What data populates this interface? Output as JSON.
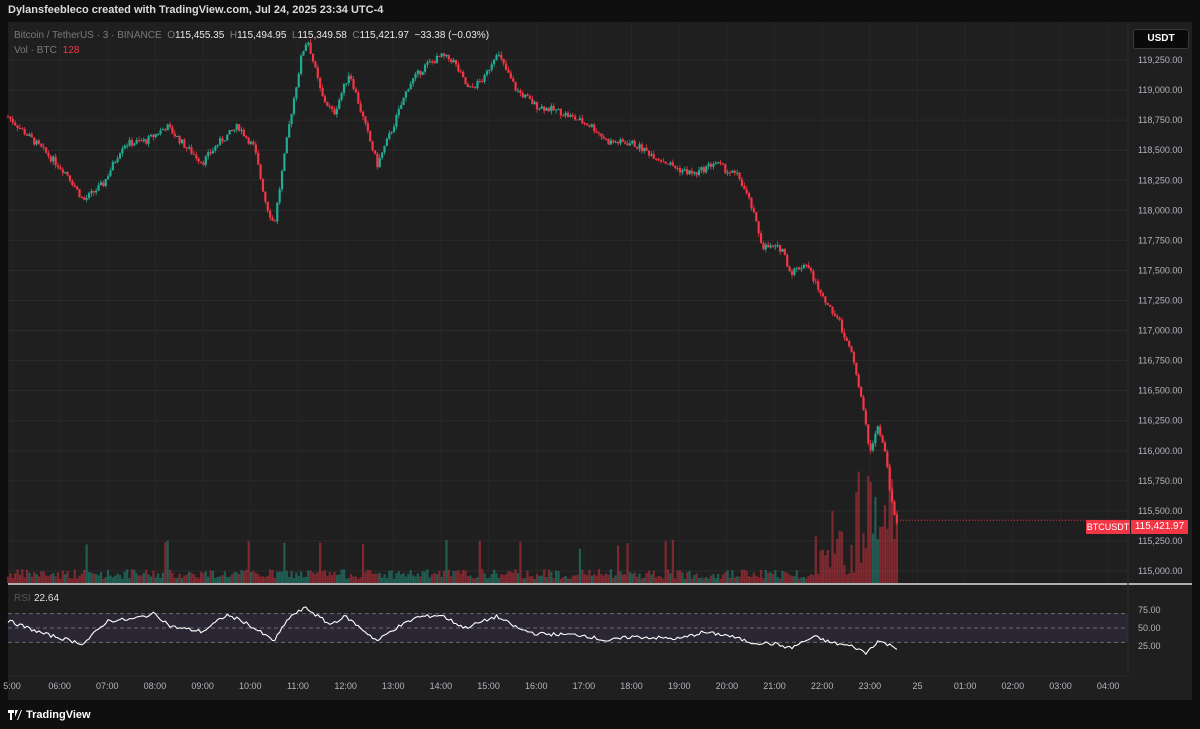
{
  "header": {
    "credit": "Dylansfeebleco created with TradingView.com, Jul 24, 2025 23:34 UTC-4"
  },
  "legend": {
    "symbol": "Bitcoin / TetherUS · 3 · BINANCE",
    "o_label": "O",
    "o": "115,455.35",
    "h_label": "H",
    "h": "115,494.95",
    "l_label": "L",
    "l": "115,349.58",
    "c_label": "C",
    "c": "115,421.97",
    "change": "−33.38 (−0.03%)",
    "vol_label": "Vol · BTC",
    "vol_value": "128",
    "rsi_label": "RSI",
    "rsi_value": "22.64"
  },
  "currency_button": "USDT",
  "price_tag": {
    "symbol": "BTCUSDT",
    "value": "115,421.97"
  },
  "footer": {
    "brand": "TradingView"
  },
  "colors": {
    "up": "#22ab94",
    "down": "#f23645",
    "rsi": "#ffffff",
    "rsi_band": "#7e57c2"
  },
  "chart_data": [
    {
      "type": "candlestick",
      "title": "Bitcoin / TetherUS · 3 · BINANCE",
      "x_labels": [
        "5:00",
        "06:00",
        "07:00",
        "08:00",
        "09:00",
        "10:00",
        "11:00",
        "12:00",
        "13:00",
        "14:00",
        "15:00",
        "16:00",
        "17:00",
        "18:00",
        "19:00",
        "20:00",
        "21:00",
        "22:00",
        "23:00",
        "25",
        "01:00",
        "02:00",
        "03:00",
        "04:00"
      ],
      "y_ticks": [
        "119,250.00",
        "119,000.00",
        "118,750.00",
        "118,500.00",
        "118,250.00",
        "118,000.00",
        "117,750.00",
        "117,500.00",
        "117,250.00",
        "117,000.00",
        "116,750.00",
        "116,500.00",
        "116,250.00",
        "116,000.00",
        "115,750.00",
        "115,500.00",
        "115,250.00",
        "115,000.00"
      ],
      "ylim": [
        114950,
        119500
      ],
      "bar_minutes": 3,
      "close_path_anchors": [
        {
          "t": "04:55",
          "p": 118780
        },
        {
          "t": "05:30",
          "p": 118560
        },
        {
          "t": "06:10",
          "p": 118300
        },
        {
          "t": "06:30",
          "p": 118080
        },
        {
          "t": "06:55",
          "p": 118220
        },
        {
          "t": "07:20",
          "p": 118550
        },
        {
          "t": "07:50",
          "p": 118580
        },
        {
          "t": "08:15",
          "p": 118700
        },
        {
          "t": "08:40",
          "p": 118520
        },
        {
          "t": "09:00",
          "p": 118400
        },
        {
          "t": "09:20",
          "p": 118560
        },
        {
          "t": "09:45",
          "p": 118700
        },
        {
          "t": "10:05",
          "p": 118520
        },
        {
          "t": "10:20",
          "p": 118050
        },
        {
          "t": "10:30",
          "p": 117880
        },
        {
          "t": "10:50",
          "p": 118750
        },
        {
          "t": "11:05",
          "p": 119300
        },
        {
          "t": "11:12",
          "p": 119430
        },
        {
          "t": "11:30",
          "p": 118950
        },
        {
          "t": "11:45",
          "p": 118800
        },
        {
          "t": "12:05",
          "p": 119150
        },
        {
          "t": "12:25",
          "p": 118700
        },
        {
          "t": "12:40",
          "p": 118380
        },
        {
          "t": "13:00",
          "p": 118700
        },
        {
          "t": "13:20",
          "p": 119050
        },
        {
          "t": "13:40",
          "p": 119200
        },
        {
          "t": "14:00",
          "p": 119280
        },
        {
          "t": "14:15",
          "p": 119250
        },
        {
          "t": "14:35",
          "p": 119000
        },
        {
          "t": "14:55",
          "p": 119100
        },
        {
          "t": "15:10",
          "p": 119320
        },
        {
          "t": "15:35",
          "p": 119000
        },
        {
          "t": "16:00",
          "p": 118870
        },
        {
          "t": "16:30",
          "p": 118820
        },
        {
          "t": "17:10",
          "p": 118700
        },
        {
          "t": "17:30",
          "p": 118570
        },
        {
          "t": "18:00",
          "p": 118560
        },
        {
          "t": "18:30",
          "p": 118450
        },
        {
          "t": "19:00",
          "p": 118340
        },
        {
          "t": "19:20",
          "p": 118300
        },
        {
          "t": "19:45",
          "p": 118400
        },
        {
          "t": "20:00",
          "p": 118330
        },
        {
          "t": "20:15",
          "p": 118280
        },
        {
          "t": "20:30",
          "p": 118050
        },
        {
          "t": "20:45",
          "p": 117700
        },
        {
          "t": "21:10",
          "p": 117680
        },
        {
          "t": "21:20",
          "p": 117480
        },
        {
          "t": "21:40",
          "p": 117560
        },
        {
          "t": "22:00",
          "p": 117280
        },
        {
          "t": "22:20",
          "p": 117100
        },
        {
          "t": "22:40",
          "p": 116750
        },
        {
          "t": "22:50",
          "p": 116400
        },
        {
          "t": "23:00",
          "p": 116000
        },
        {
          "t": "23:10",
          "p": 116200
        },
        {
          "t": "23:20",
          "p": 115950
        },
        {
          "t": "23:30",
          "p": 115450
        },
        {
          "t": "23:34",
          "p": 115421.97
        }
      ],
      "volume": {
        "label": "Vol · BTC",
        "last": 128,
        "note": "spikes late 22:00–23:30"
      }
    },
    {
      "type": "line",
      "title": "RSI",
      "y_ticks": [
        "75.00",
        "50.00",
        "25.00"
      ],
      "ylim": [
        0,
        100
      ],
      "band": [
        30,
        70
      ],
      "last": 22.64,
      "path_anchors": [
        {
          "t": "04:55",
          "v": 60
        },
        {
          "t": "05:40",
          "v": 42
        },
        {
          "t": "06:30",
          "v": 28
        },
        {
          "t": "07:00",
          "v": 60
        },
        {
          "t": "07:30",
          "v": 62
        },
        {
          "t": "08:00",
          "v": 70
        },
        {
          "t": "08:20",
          "v": 52
        },
        {
          "t": "09:00",
          "v": 45
        },
        {
          "t": "09:30",
          "v": 68
        },
        {
          "t": "09:50",
          "v": 60
        },
        {
          "t": "10:30",
          "v": 32
        },
        {
          "t": "10:50",
          "v": 66
        },
        {
          "t": "11:10",
          "v": 78
        },
        {
          "t": "11:40",
          "v": 55
        },
        {
          "t": "12:00",
          "v": 66
        },
        {
          "t": "12:40",
          "v": 32
        },
        {
          "t": "13:00",
          "v": 48
        },
        {
          "t": "13:30",
          "v": 65
        },
        {
          "t": "14:00",
          "v": 68
        },
        {
          "t": "14:30",
          "v": 50
        },
        {
          "t": "15:10",
          "v": 66
        },
        {
          "t": "15:40",
          "v": 48
        },
        {
          "t": "16:00",
          "v": 42
        },
        {
          "t": "17:00",
          "v": 40
        },
        {
          "t": "17:30",
          "v": 32
        },
        {
          "t": "18:00",
          "v": 38
        },
        {
          "t": "19:00",
          "v": 35
        },
        {
          "t": "19:30",
          "v": 44
        },
        {
          "t": "20:00",
          "v": 40
        },
        {
          "t": "20:30",
          "v": 30
        },
        {
          "t": "21:00",
          "v": 28
        },
        {
          "t": "21:20",
          "v": 22
        },
        {
          "t": "21:50",
          "v": 38
        },
        {
          "t": "22:10",
          "v": 30
        },
        {
          "t": "22:40",
          "v": 24
        },
        {
          "t": "22:55",
          "v": 15
        },
        {
          "t": "23:10",
          "v": 32
        },
        {
          "t": "23:34",
          "v": 22.64
        }
      ]
    }
  ]
}
